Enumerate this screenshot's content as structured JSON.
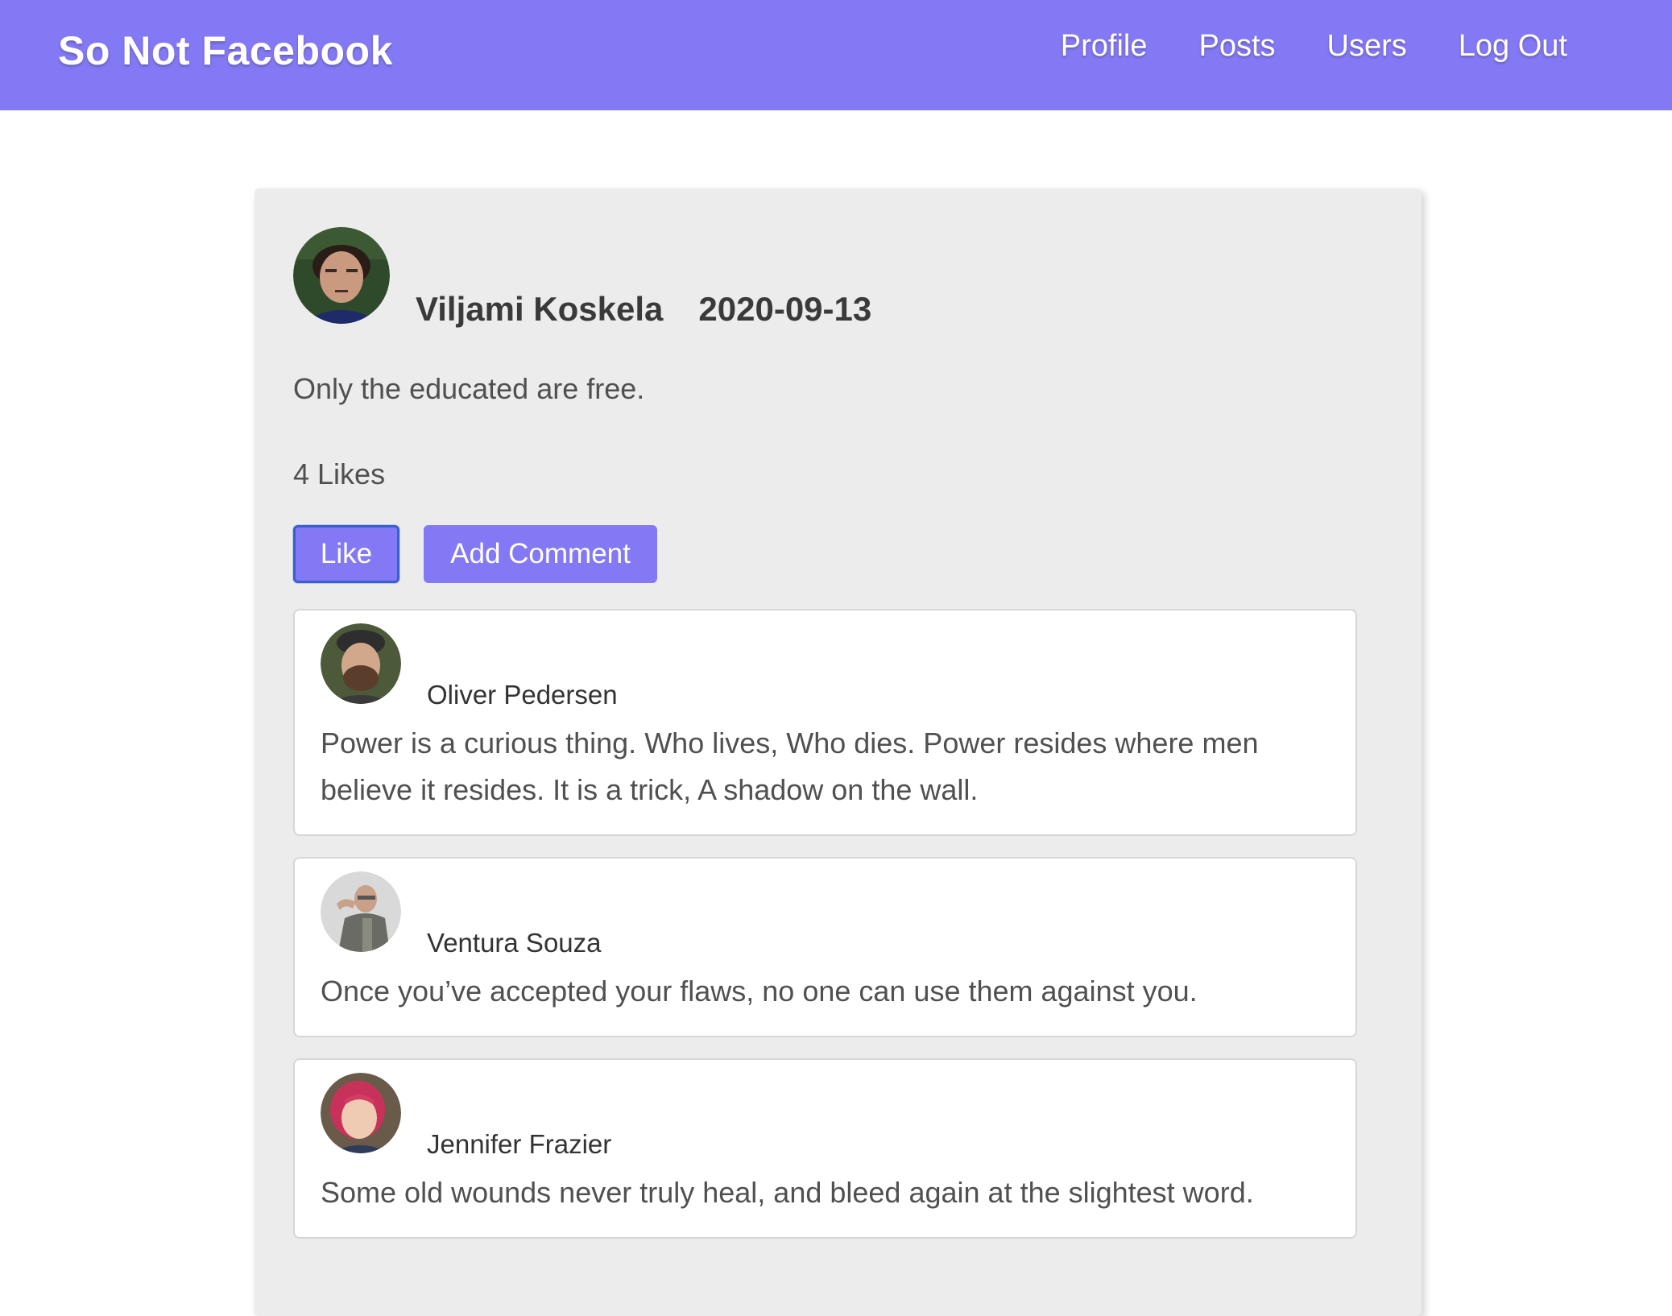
{
  "navbar": {
    "brand": "So Not Facebook",
    "links": [
      {
        "label": "Profile"
      },
      {
        "label": "Posts"
      },
      {
        "label": "Users"
      },
      {
        "label": "Log Out"
      }
    ]
  },
  "post": {
    "author": "Viljami Koskela",
    "date": "2020-09-13",
    "content": "Only the educated are free.",
    "likes_text": "4 Likes",
    "like_button": "Like",
    "add_comment_button": "Add Comment"
  },
  "comments": [
    {
      "author": "Oliver Pedersen",
      "text": "Power is a curious thing. Who lives, Who dies. Power resides where men believe it resides. It is a trick, A shadow on the wall."
    },
    {
      "author": "Ventura Souza",
      "text": "Once you’ve accepted your flaws, no one can use them against you."
    },
    {
      "author": "Jennifer Frazier",
      "text": "Some old wounds never truly heal, and bleed again at the slightest word."
    }
  ],
  "colors": {
    "accent": "#8479f4",
    "card_bg": "#ececec",
    "focus_ring": "#3a5fcf"
  },
  "icons": {
    "post_avatar": "user-avatar-photo",
    "comment_avatar": "commenter-avatar-photo"
  }
}
